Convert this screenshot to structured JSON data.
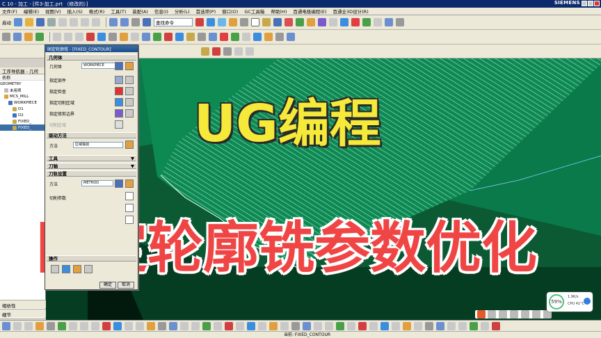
{
  "window": {
    "title": "C 10 - 加工 - [件3-加工.prt （修改的）]",
    "brand": "SIEMENS"
  },
  "menu": [
    "文件(F)",
    "编辑(E)",
    "视图(V)",
    "插入(S)",
    "格式(R)",
    "工具(T)",
    "装配(A)",
    "信息(I)",
    "分析(L)",
    "首选项(P)",
    "窗口(O)",
    "GC工具箱",
    "帮助(H)",
    "百通电极编程(E)",
    "百通全3D设计(R)"
  ],
  "toolbar": {
    "start_label": "启动",
    "search_placeholder": "查找命令"
  },
  "navigator": {
    "title": "工序导航器 - 几何",
    "column_header": "名称",
    "rows": [
      "GEOMETRY",
      "未用项",
      "MCS_MILL",
      "WORKPIECE",
      "D1",
      "D2",
      "FIXED_",
      "FIXED_"
    ],
    "lower_panels": [
      "相依性",
      "细节"
    ]
  },
  "dialog": {
    "title": "固定轮廓铣 - [FIXED_CONTOUR]",
    "geometry": {
      "section": "几何体",
      "geometry_label": "几何体",
      "geometry_value": "WORKPIECE",
      "part_label": "指定部件",
      "check_label": "指定检查",
      "cut_area_label": "指定切削区域",
      "trim_label": "指定修剪边界",
      "wall_label": "切削区域"
    },
    "drive": {
      "section": "驱动方法",
      "method_label": "方法",
      "method_value": "区域铣削"
    },
    "tool_section": "工具",
    "axis_section": "刀轴",
    "path": {
      "section": "刀轨设置",
      "method_label": "方法",
      "method_value": "METHOD",
      "cut_params_label": "切削参数"
    },
    "ops_section": "操作",
    "ok": "确定",
    "cancel": "取消"
  },
  "overlay": {
    "title": "UG编程",
    "subtitle": "固定轮廓铣参数优化"
  },
  "status": {
    "current": "当前: FIXED_CONTOUR"
  },
  "monitor": {
    "percent": "59%",
    "net": "1.9K/s",
    "cpu": "CPU 41°C"
  },
  "colors": {
    "viewport_green": "#0a7a4a",
    "dark_green": "#053d22",
    "toolpath": "#d9f7ff",
    "title_yellow": "#f5e93a",
    "title_red": "#f04545"
  }
}
